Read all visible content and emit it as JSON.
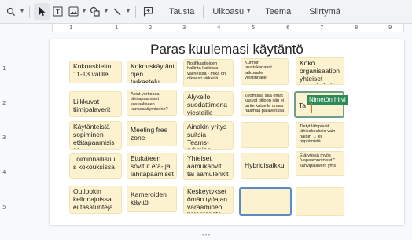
{
  "toolbar": {
    "background_label": "Tausta",
    "layout_label": "Ulkoasu",
    "theme_label": "Teema",
    "transition_label": "Siirtymä"
  },
  "ruler": {
    "top_ticks": [
      "1",
      "1",
      "2",
      "3",
      "4",
      "5",
      "6",
      "7",
      "8",
      "9"
    ],
    "left_ticks": [
      "1",
      "2",
      "3",
      "4",
      "5"
    ]
  },
  "slide": {
    "title": "Paras kuulemasi käytäntö",
    "notes": [
      "Kokouskielto 11-13 välille",
      "Kokouskäytänt öjen tarkastelu uudelleen",
      "Notifikaatioiden hallinta kaikissa välineissä - mikä on oikeesti tärkeää",
      "Kunnon taustakanavat jatkuvalle viestinnälle",
      "Koko organisaation yhteiset aamukahvit etänä",
      "Liikkuvat tiimipalaverit",
      "Asiat verkossa, lähitapaamiset sosiaaliseen kanssakäymiseen?",
      "Älykello suodattimena viesteille",
      "Zoomissa saa omat kasvot piiloon niin ei tartte katsella omaa naamaa palaverissa",
      "Ta",
      "Käytänteistä sopiminen etätapaamisis sa",
      "Meeting free zone",
      "Ainakin yritys suitsia Teams-ryhmien määrää ;-)",
      "",
      "Tietyt lähipävät → lähikokouksia vain näihin → ei hyppimistä",
      "Toiminnallisuu s kokouksissa",
      "Etukäteen sovitut etä- ja lähitapaamiset",
      "Yhteiset aamukahvit tai aamulenkit etänä",
      "Hybridisalkku",
      "Etäryössä myös \"vapaamuotoiset \" kahvipalaverit yms",
      "Outlookin kellonajoissa ei tasatunteja",
      "Kameroiden käyttö",
      "Keskeytykset ömän työajan varaaminen kalenterista",
      "",
      ""
    ],
    "active_user_tag": "Nimetön hirvi"
  },
  "colors": {
    "note_fill": "#fdf2cf",
    "selection_blue": "#5b8cc0",
    "user_tag_green": "#2e8b57",
    "cursor_orange": "#e06f24"
  }
}
